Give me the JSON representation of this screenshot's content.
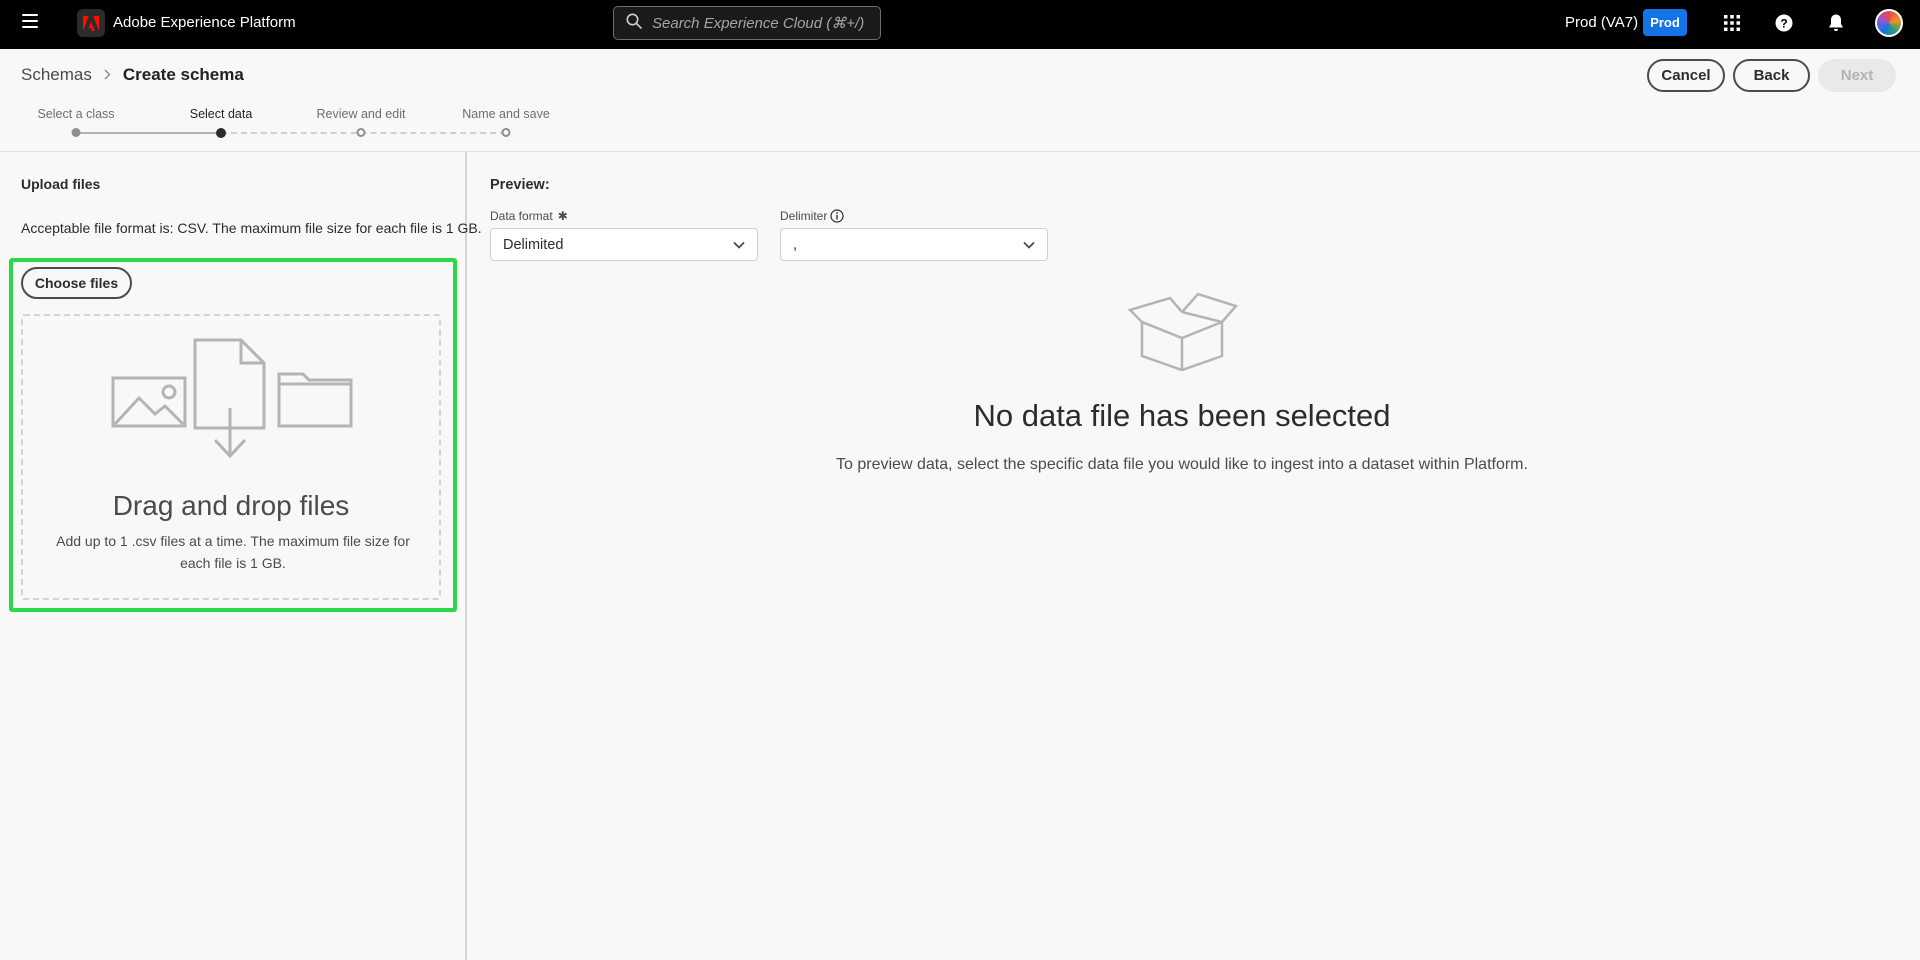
{
  "topbar": {
    "app_title": "Adobe Experience Platform",
    "search_placeholder": "Search Experience Cloud (⌘+/)",
    "org_name": "Prod (VA7)",
    "env_badge": "Prod",
    "icons": [
      "menu-icon",
      "adobe-logo-icon",
      "search-icon",
      "apps-grid-icon",
      "help-icon",
      "notification-bell-icon",
      "user-avatar"
    ]
  },
  "breadcrumb": {
    "parent": "Schemas",
    "current": "Create schema"
  },
  "actions": {
    "cancel": "Cancel",
    "back": "Back",
    "next": "Next"
  },
  "stepper": {
    "steps": [
      {
        "label": "Select a class",
        "state": "complete"
      },
      {
        "label": "Select data",
        "state": "active"
      },
      {
        "label": "Review and edit",
        "state": "upcoming"
      },
      {
        "label": "Name and save",
        "state": "upcoming"
      }
    ]
  },
  "upload": {
    "title": "Upload files",
    "description": "Acceptable file format is: CSV. The maximum file size for each file is 1 GB.",
    "choose_button": "Choose files",
    "dropzone_title": "Drag and drop files",
    "dropzone_desc": "Add up to 1 .csv files at a time. The maximum file size for each file is 1 GB."
  },
  "preview": {
    "title": "Preview:",
    "data_format_label": "Data format",
    "data_format_value": "Delimited",
    "delimiter_label": "Delimiter",
    "delimiter_value": ",",
    "empty_title": "No data file has been selected",
    "empty_desc": "To preview data, select the specific data file you would like to ingest into a dataset within Platform."
  },
  "colors": {
    "topbar_bg": "#000000",
    "accent_blue": "#1473e6",
    "highlight_green": "#2ed64a",
    "adobe_red": "#fa0f00"
  }
}
